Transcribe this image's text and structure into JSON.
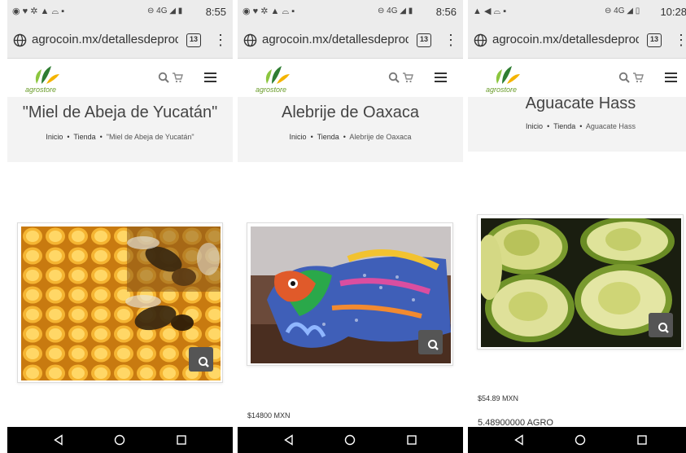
{
  "phones": [
    {
      "status": {
        "time": "8:55",
        "net": "4G"
      },
      "browser": {
        "url": "agrocoin.mx/detallesdeprod",
        "tab_count": "13"
      },
      "logo_text": "agrostore",
      "page_title": "\"Miel de Abeja de Yucatán\"",
      "breadcrumb": {
        "home": "Inicio",
        "shop": "Tienda",
        "current": "\"Miel de Abeja de Yucatán\""
      },
      "product_image": "honeycomb-with-bees",
      "price": "",
      "agro_price": ""
    },
    {
      "status": {
        "time": "8:56",
        "net": "4G"
      },
      "browser": {
        "url": "agrocoin.mx/detallesdeprod",
        "tab_count": "13"
      },
      "logo_text": "agrostore",
      "page_title": "Alebrije de Oaxaca",
      "breadcrumb": {
        "home": "Inicio",
        "shop": "Tienda",
        "current": "Alebrije de Oaxaca"
      },
      "product_image": "alebrije-jaguar-sculpture",
      "price": "$14800 MXN",
      "agro_price": ""
    },
    {
      "status": {
        "time": "10:28",
        "net": "4G"
      },
      "browser": {
        "url": "agrocoin.mx/detallesdeprod",
        "tab_count": "13"
      },
      "logo_text": "agrostore",
      "page_title": "Aguacate Hass",
      "breadcrumb": {
        "home": "Inicio",
        "shop": "Tienda",
        "current": "Aguacate Hass"
      },
      "product_image": "halved-avocados",
      "price": "$54.89 MXN",
      "agro_price": "5.48900000 AGRO"
    }
  ],
  "icons": {
    "globe": "globe-icon",
    "tabs": "tab-switcher-icon",
    "menu": "overflow-menu-icon",
    "search": "search-icon",
    "cart": "cart-icon",
    "hamburger": "hamburger-icon",
    "zoom": "zoom-icon",
    "back": "back-triangle-icon",
    "home": "home-circle-icon",
    "recents": "recents-square-icon"
  },
  "colors": {
    "status_bar": "#ececec",
    "hero_bg": "#f3f3f3",
    "logo_green": "#6a9c2a",
    "nav_bar": "#000000",
    "zoom_button": "#555555"
  }
}
